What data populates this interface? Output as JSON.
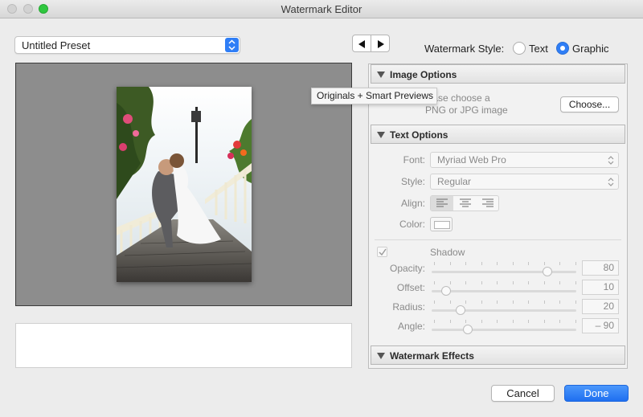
{
  "window": {
    "title": "Watermark Editor"
  },
  "preset": {
    "value": "Untitled Preset"
  },
  "watermark_style": {
    "label": "Watermark Style:",
    "options": [
      {
        "label": "Text",
        "selected": false
      },
      {
        "label": "Graphic",
        "selected": true
      }
    ]
  },
  "tooltip": {
    "text": "Originals + Smart Previews"
  },
  "image_options": {
    "header": "Image Options",
    "prompt_line1": "lease choose a",
    "prompt_line2": "PNG or JPG image",
    "choose_label": "Choose..."
  },
  "text_options": {
    "header": "Text Options",
    "font_label": "Font:",
    "font_value": "Myriad Web Pro",
    "style_label": "Style:",
    "style_value": "Regular",
    "align_label": "Align:",
    "align_selected": "left",
    "color_label": "Color:",
    "shadow_label": "Shadow",
    "shadow_checked": true,
    "sliders": [
      {
        "label": "Opacity:",
        "value": "80",
        "fraction": 0.8
      },
      {
        "label": "Offset:",
        "value": "10",
        "fraction": 0.1
      },
      {
        "label": "Radius:",
        "value": "20",
        "fraction": 0.2
      },
      {
        "label": "Angle:",
        "value": "– 90",
        "fraction": 0.25
      }
    ]
  },
  "watermark_effects": {
    "header": "Watermark Effects"
  },
  "buttons": {
    "cancel": "Cancel",
    "done": "Done"
  },
  "colors": {
    "accent": "#2f7ef6",
    "preview_bg": "#8d8d8d"
  }
}
